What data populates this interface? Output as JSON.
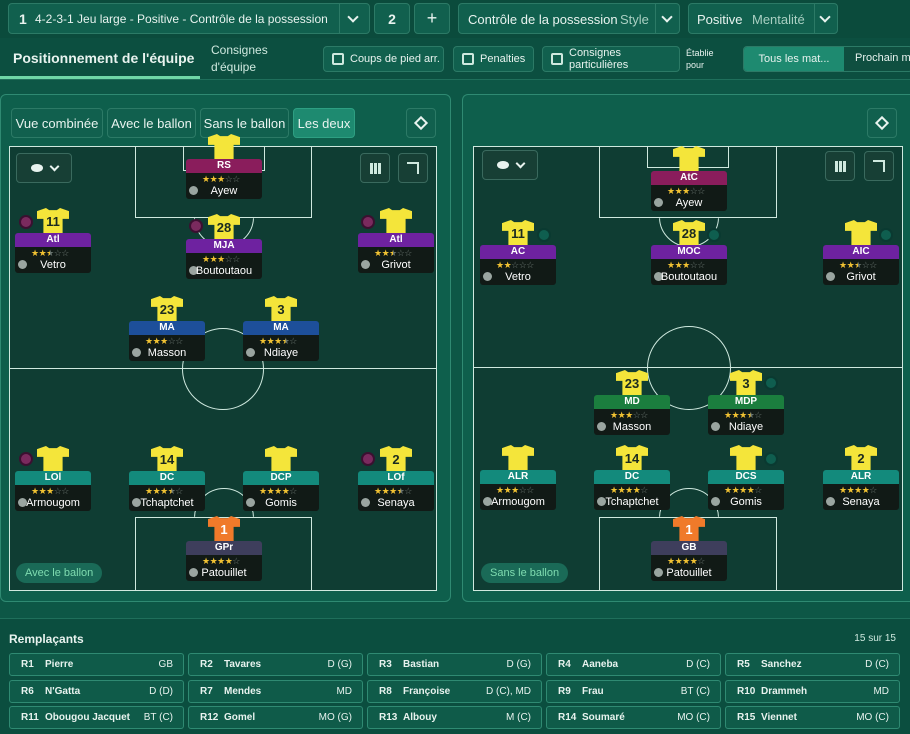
{
  "topbar": {
    "tactic_num": "1",
    "tactic_name": "4-2-3-1 Jeu large - Positive - Contrôle de la possession",
    "slot_num": "2",
    "add_label": "+",
    "style_value": "Contrôle de la possession",
    "style_label": "Style",
    "mentality_value": "Positive",
    "mentality_label": "Mentalité"
  },
  "subbar": {
    "title": "Positionnement de l'équipe",
    "instructions_l1": "Consignes",
    "instructions_l2": "d'équipe",
    "set_pieces": "Coups de pied arr.",
    "penalties": "Penalties",
    "special": "Consignes particulières",
    "set_for_l1": "Établie",
    "set_for_l2": "pour",
    "all_matches": "Tous les mat...",
    "next_match": "Prochain m"
  },
  "view_tabs": [
    "Vue combinée",
    "Avec le ballon",
    "Sans le ballon",
    "Les deux"
  ],
  "left_tag": "Avec le ballon",
  "right_tag": "Sans le ballon",
  "colors": {
    "st": "#8a1d5c",
    "am": "#6e22a0",
    "cm": "#1d4f9a",
    "def": "#138a7c",
    "dm": "#1b7e3e",
    "gk": "#3e3e5c"
  },
  "left_players": [
    {
      "num": "",
      "role": "RS",
      "name": "Ayew",
      "stars": 3,
      "color": "st",
      "gk": false
    },
    {
      "num": "11",
      "role": "Atl",
      "name": "Vetro",
      "stars": 2.5,
      "color": "am",
      "gk": false
    },
    {
      "num": "28",
      "role": "MJA",
      "name": "Boutoutaou",
      "stars": 3,
      "color": "am",
      "gk": false
    },
    {
      "num": "",
      "role": "Atl",
      "name": "Grivot",
      "stars": 2.5,
      "color": "am",
      "gk": false
    },
    {
      "num": "23",
      "role": "MA",
      "name": "Masson",
      "stars": 3,
      "color": "cm",
      "gk": false
    },
    {
      "num": "3",
      "role": "MA",
      "name": "Ndiaye",
      "stars": 3.5,
      "color": "cm",
      "gk": false
    },
    {
      "num": "",
      "role": "LOl",
      "name": "Armougom",
      "stars": 3,
      "color": "def",
      "gk": false
    },
    {
      "num": "14",
      "role": "DC",
      "name": "Tchaptchet",
      "stars": 3.5,
      "color": "def",
      "gk": false
    },
    {
      "num": "",
      "role": "DCP",
      "name": "Gomis",
      "stars": 4,
      "color": "def",
      "gk": false
    },
    {
      "num": "2",
      "role": "LOf",
      "name": "Senaya",
      "stars": 3.5,
      "color": "def",
      "gk": false
    },
    {
      "num": "1",
      "role": "GPr",
      "name": "Patouillet",
      "stars": 4,
      "color": "gk",
      "gk": true
    }
  ],
  "right_players": [
    {
      "num": "",
      "role": "AtC",
      "name": "Ayew",
      "stars": 3,
      "color": "st",
      "gk": false
    },
    {
      "num": "11",
      "role": "AC",
      "name": "Vetro",
      "stars": 2,
      "color": "am",
      "gk": false
    },
    {
      "num": "28",
      "role": "MOC",
      "name": "Boutoutaou",
      "stars": 3,
      "color": "am",
      "gk": false
    },
    {
      "num": "",
      "role": "AIC",
      "name": "Grivot",
      "stars": 2.5,
      "color": "am",
      "gk": false
    },
    {
      "num": "23",
      "role": "MD",
      "name": "Masson",
      "stars": 3,
      "color": "dm",
      "gk": false
    },
    {
      "num": "3",
      "role": "MDP",
      "name": "Ndiaye",
      "stars": 3.5,
      "color": "dm",
      "gk": false
    },
    {
      "num": "",
      "role": "ALR",
      "name": "Armougom",
      "stars": 3,
      "color": "def",
      "gk": false
    },
    {
      "num": "14",
      "role": "DC",
      "name": "Tchaptchet",
      "stars": 4,
      "color": "def",
      "gk": false
    },
    {
      "num": "",
      "role": "DCS",
      "name": "Gomis",
      "stars": 4,
      "color": "def",
      "gk": false
    },
    {
      "num": "2",
      "role": "ALR",
      "name": "Senaya",
      "stars": 4,
      "color": "def",
      "gk": false
    },
    {
      "num": "1",
      "role": "GB",
      "name": "Patouillet",
      "stars": 4,
      "color": "gk",
      "gk": true
    }
  ],
  "subs_title": "Remplaçants",
  "subs_count": "15 sur 15",
  "subs": [
    {
      "num": "R1",
      "name": "Pierre",
      "pos": "GB"
    },
    {
      "num": "R2",
      "name": "Tavares",
      "pos": "D (G)"
    },
    {
      "num": "R3",
      "name": "Bastian",
      "pos": "D (G)"
    },
    {
      "num": "R4",
      "name": "Aaneba",
      "pos": "D (C)"
    },
    {
      "num": "R5",
      "name": "Sanchez",
      "pos": "D (C)"
    },
    {
      "num": "R6",
      "name": "N'Gatta",
      "pos": "D (D)"
    },
    {
      "num": "R7",
      "name": "Mendes",
      "pos": "MD"
    },
    {
      "num": "R8",
      "name": "Françoise",
      "pos": "D (C), MD"
    },
    {
      "num": "R9",
      "name": "Frau",
      "pos": "BT (C)"
    },
    {
      "num": "R10",
      "name": "Drammeh",
      "pos": "MD"
    },
    {
      "num": "R11",
      "name": "Obougou Jacquet",
      "pos": "BT (C)"
    },
    {
      "num": "R12",
      "name": "Gomel",
      "pos": "MO (G)"
    },
    {
      "num": "R13",
      "name": "Albouy",
      "pos": "M (C)"
    },
    {
      "num": "R14",
      "name": "Soumaré",
      "pos": "MO (C)"
    },
    {
      "num": "R15",
      "name": "Viennet",
      "pos": "MO (C)"
    }
  ]
}
